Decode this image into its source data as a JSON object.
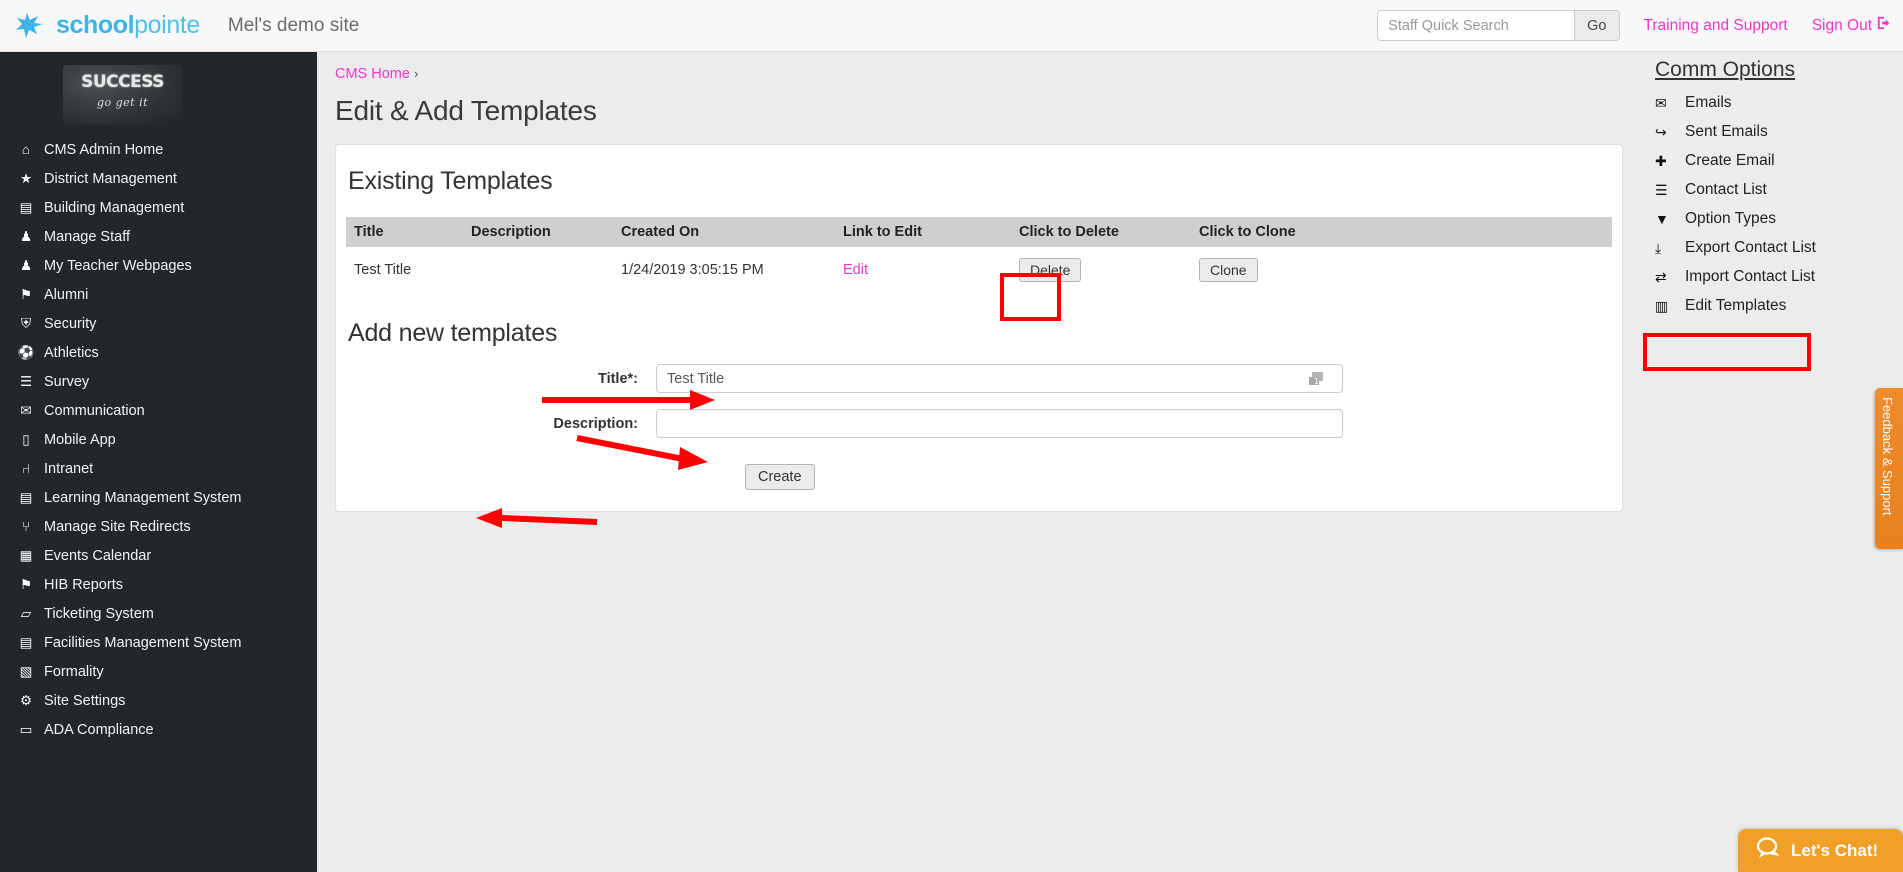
{
  "topbar": {
    "brand_bold": "school",
    "brand_light": "pointe",
    "site_name": "Mel's demo site",
    "search_placeholder": "Staff Quick Search",
    "search_value": "",
    "go_label": "Go",
    "training_link": "Training and Support",
    "signout_link": "Sign Out",
    "signout_icon": "sign-out-icon",
    "logo_icon": "schoolpointe-star-logo"
  },
  "sidebar": {
    "photo_alt": "success-chalkboard-image",
    "photo_text_top": "SUCCESS",
    "photo_text_bottom": "go get it",
    "items": [
      {
        "label": "CMS Admin Home",
        "icon": "home-icon",
        "glyph": "⌂"
      },
      {
        "label": "District Management",
        "icon": "star-icon",
        "glyph": "★"
      },
      {
        "label": "Building Management",
        "icon": "building-icon",
        "glyph": "▤"
      },
      {
        "label": "Manage Staff",
        "icon": "users-icon",
        "glyph": "♟"
      },
      {
        "label": "My Teacher Webpages",
        "icon": "user-icon",
        "glyph": "♟"
      },
      {
        "label": "Alumni",
        "icon": "graduation-cap-icon",
        "glyph": "⚑"
      },
      {
        "label": "Security",
        "icon": "shield-icon",
        "glyph": "⛨"
      },
      {
        "label": "Athletics",
        "icon": "soccer-ball-icon",
        "glyph": "⚽"
      },
      {
        "label": "Survey",
        "icon": "list-icon",
        "glyph": "☰"
      },
      {
        "label": "Communication",
        "icon": "envelope-icon",
        "glyph": "✉"
      },
      {
        "label": "Mobile App",
        "icon": "mobile-icon",
        "glyph": "▯"
      },
      {
        "label": "Intranet",
        "icon": "sitemap-icon",
        "glyph": "⑁"
      },
      {
        "label": "Learning Management System",
        "icon": "book-icon",
        "glyph": "▤"
      },
      {
        "label": "Manage Site Redirects",
        "icon": "code-branch-icon",
        "glyph": "⑂"
      },
      {
        "label": "Events Calendar",
        "icon": "calendar-icon",
        "glyph": "▦"
      },
      {
        "label": "HIB Reports",
        "icon": "flag-icon",
        "glyph": "⚑"
      },
      {
        "label": "Ticketing System",
        "icon": "ticket-icon",
        "glyph": "▱"
      },
      {
        "label": "Facilities Management System",
        "icon": "building-list-icon",
        "glyph": "▤"
      },
      {
        "label": "Formality",
        "icon": "document-icon",
        "glyph": "▧"
      },
      {
        "label": "Site Settings",
        "icon": "gears-icon",
        "glyph": "⚙"
      },
      {
        "label": "ADA Compliance",
        "icon": "desktop-icon",
        "glyph": "▭"
      }
    ]
  },
  "breadcrumb": {
    "home_label": "CMS Home",
    "separator": "›"
  },
  "page": {
    "title": "Edit & Add Templates"
  },
  "existing": {
    "heading": "Existing Templates",
    "columns": [
      "Title",
      "Description",
      "Created On",
      "Link to Edit",
      "Click to Delete",
      "Click to Clone"
    ],
    "rows": [
      {
        "title": "Test Title",
        "description": "",
        "created_on": "1/24/2019 3:05:15 PM",
        "edit_label": "Edit",
        "delete_label": "Delete",
        "clone_label": "Clone"
      }
    ]
  },
  "add_form": {
    "heading": "Add new templates",
    "title_label": "Title*:",
    "title_value": "Test Title",
    "title_placeholder": "",
    "title_badge_icon": "autofill-badge-icon",
    "description_label": "Description:",
    "description_value": "",
    "description_placeholder": "",
    "create_label": "Create"
  },
  "comm_options": {
    "title": "Comm Options",
    "items": [
      {
        "label": "Emails",
        "icon": "envelope-icon",
        "glyph": "✉"
      },
      {
        "label": "Sent Emails",
        "icon": "share-square-icon",
        "glyph": "↪"
      },
      {
        "label": "Create Email",
        "icon": "plus-square-icon",
        "glyph": "✚"
      },
      {
        "label": "Contact List",
        "icon": "list-ul-icon",
        "glyph": "☰"
      },
      {
        "label": "Option Types",
        "icon": "filter-icon",
        "glyph": "▼"
      },
      {
        "label": "Export Contact List",
        "icon": "download-icon",
        "glyph": "⤓"
      },
      {
        "label": "Import Contact List",
        "icon": "exchange-icon",
        "glyph": "⇄"
      },
      {
        "label": "Edit Templates",
        "icon": "columns-icon",
        "glyph": "▥"
      }
    ],
    "active_item": "Edit Templates"
  },
  "feedback_tab": {
    "label": "Feedback & Support"
  },
  "chat_widget": {
    "label": "Let's Chat!",
    "icon": "chat-bubble-icon"
  },
  "annotations": {
    "highlight_color": "#ff0000",
    "boxes": [
      "edit-link-highlight",
      "edit-templates-highlight"
    ],
    "arrows": [
      "title-field-arrow",
      "description-field-arrow",
      "create-button-arrow"
    ]
  },
  "colors": {
    "accent_pink": "#ee36c8",
    "brand_blue": "#3fb3e3",
    "sidebar_bg": "#22272b",
    "page_bg": "#ececec",
    "annotation_red": "#ff0000",
    "feedback_orange": "#e8821f",
    "chat_orange": "#f0a028"
  }
}
